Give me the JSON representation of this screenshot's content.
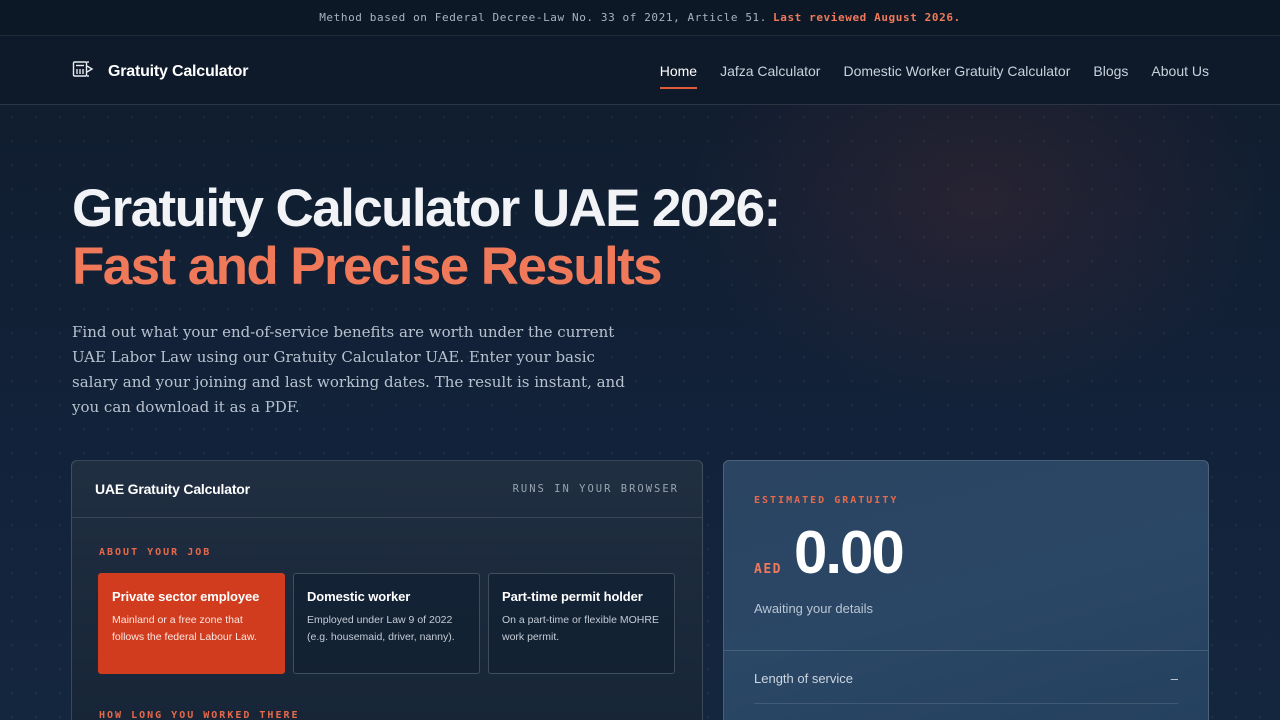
{
  "topbar": {
    "text": "Method based on Federal Decree-Law No. 33 of 2021, Article 51.",
    "highlight": "Last reviewed August 2026."
  },
  "nav": {
    "logo_icon": "calculator-icon",
    "logo_title": "Gratuity Calculator",
    "links": [
      {
        "label": "Home",
        "active": true
      },
      {
        "label": "Jafza Calculator"
      },
      {
        "label": "Domestic Worker Gratuity Calculator"
      },
      {
        "label": "Blogs"
      },
      {
        "label": "About Us"
      }
    ]
  },
  "hero": {
    "title": "Gratuity Calculator UAE 2026:",
    "title_accent": "Fast and Precise Results",
    "description": "Find out what your end-of-service benefits are worth under the current UAE Labor Law using our Gratuity Calculator UAE. Enter your basic salary and your joining and last working dates. The result is instant, and you can download it as a PDF."
  },
  "calculator": {
    "title": "UAE Gratuity Calculator",
    "tag": "RUNS IN YOUR BROWSER",
    "section_job": "ABOUT YOUR JOB",
    "section_duration": "HOW LONG YOU WORKED THERE",
    "options": [
      {
        "title": "Private sector employee",
        "desc": "Mainland or a free zone that follows the federal Labour Law.",
        "selected": true
      },
      {
        "title": "Domestic worker",
        "desc": "Employed under Law 9 of 2022 (e.g. housemaid, driver, nanny)."
      },
      {
        "title": "Part-time permit holder",
        "desc": "On a part-time or flexible MOHRE work permit."
      }
    ]
  },
  "result": {
    "label": "ESTIMATED GRATUITY",
    "currency": "AED",
    "amount": "0.00",
    "status": "Awaiting your details",
    "service_label": "Length of service",
    "service_value": "–"
  },
  "colors": {
    "accent": "#f0795a",
    "selected": "#d13c1f",
    "background": "#0f1b2b"
  }
}
